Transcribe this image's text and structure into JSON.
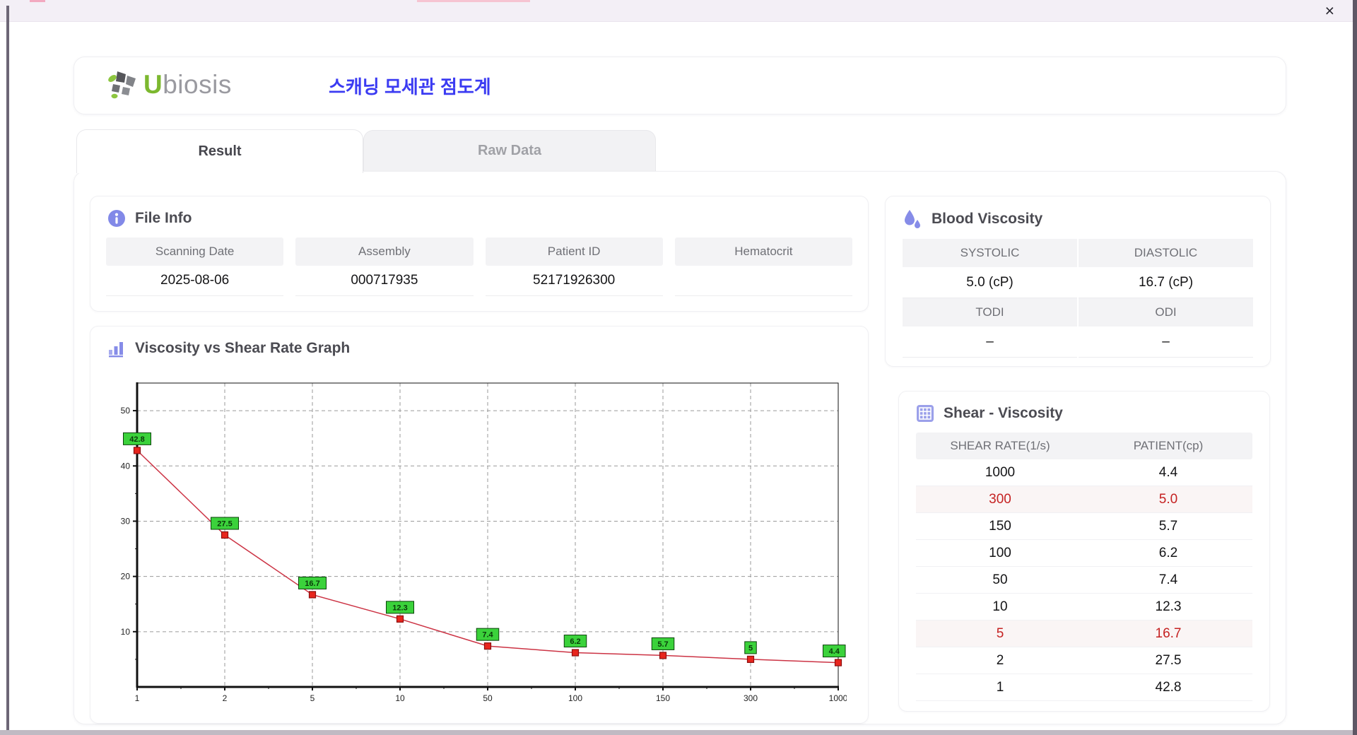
{
  "window": {
    "close": "×"
  },
  "theme": {
    "accent_purple": "#868ce8",
    "title_blue": "#3b3bf2",
    "logo_green": "#7cb82f",
    "alert_red": "#c52222"
  },
  "header": {
    "logo": {
      "u": "U",
      "rest": "biosis"
    },
    "app_title": "스캐닝 모세관 점도계"
  },
  "tabs": [
    {
      "label": "Result"
    },
    {
      "label": "Raw Data"
    }
  ],
  "file_info": {
    "title": "File Info",
    "fields": [
      {
        "label": "Scanning Date",
        "value": "2025-08-06"
      },
      {
        "label": "Assembly",
        "value": "000717935"
      },
      {
        "label": "Patient ID",
        "value": "52171926300"
      },
      {
        "label": "Hematocrit",
        "value": ""
      }
    ]
  },
  "blood_viscosity": {
    "title": "Blood Viscosity",
    "pairs": [
      {
        "h1": "SYSTOLIC",
        "h2": "DIASTOLIC",
        "v1": "5.0 (cP)",
        "v2": "16.7 (cP)"
      },
      {
        "h1": "TODI",
        "h2": "ODI",
        "v1": "–",
        "v2": "–"
      }
    ]
  },
  "graph": {
    "title": "Viscosity vs Shear Rate Graph"
  },
  "shear_viscosity": {
    "title": "Shear - Viscosity",
    "columns": [
      "SHEAR RATE(1/s)",
      "PATIENT(cp)"
    ],
    "rows": [
      {
        "rate": "1000",
        "patient": "4.4",
        "highlight": false
      },
      {
        "rate": "300",
        "patient": "5.0",
        "highlight": true
      },
      {
        "rate": "150",
        "patient": "5.7",
        "highlight": false
      },
      {
        "rate": "100",
        "patient": "6.2",
        "highlight": false
      },
      {
        "rate": "50",
        "patient": "7.4",
        "highlight": false
      },
      {
        "rate": "10",
        "patient": "12.3",
        "highlight": false
      },
      {
        "rate": "5",
        "patient": "16.7",
        "highlight": true
      },
      {
        "rate": "2",
        "patient": "27.5",
        "highlight": false
      },
      {
        "rate": "1",
        "patient": "42.8",
        "highlight": false
      }
    ]
  },
  "chart_data": {
    "type": "line",
    "title": "Viscosity vs Shear Rate Graph",
    "x_categories": [
      "1",
      "2",
      "5",
      "10",
      "50",
      "100",
      "150",
      "300",
      "1000"
    ],
    "series": [
      {
        "name": "PATIENT(cp)",
        "values": [
          42.8,
          27.5,
          16.7,
          12.3,
          7.4,
          6.2,
          5.7,
          5.0,
          4.4
        ]
      }
    ],
    "point_labels": [
      "42.8",
      "27.5",
      "16.7",
      "12.3",
      "7.4",
      "6.2",
      "5.7",
      "5",
      "4.4"
    ],
    "xlabel": "",
    "ylabel": "",
    "ylim": [
      0,
      55
    ],
    "yticks": [
      10,
      20,
      30,
      40,
      50
    ],
    "grid": true,
    "x_scale": "categorical (log-like spacing)",
    "legend_position": "none",
    "colors": {
      "line": "#cc3344",
      "marker": "#e8251d",
      "marker_border": "#8c0f0f",
      "label_bg": "#3bd23b",
      "label_border": "#0a420a",
      "label_text": "#0a3a0a"
    }
  }
}
